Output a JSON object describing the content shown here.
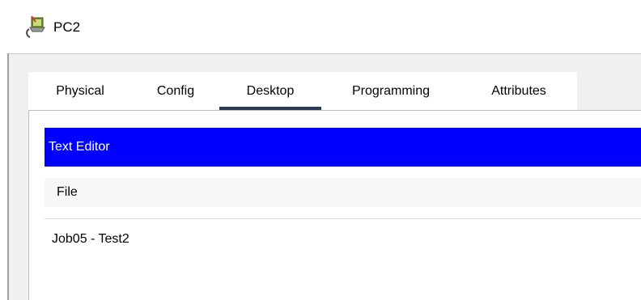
{
  "window": {
    "title": "PC2",
    "icon": "pc-device-icon"
  },
  "tabs": [
    {
      "label": "Physical",
      "active": false
    },
    {
      "label": "Config",
      "active": false
    },
    {
      "label": "Desktop",
      "active": true
    },
    {
      "label": "Programming",
      "active": false
    },
    {
      "label": "Attributes",
      "active": false
    }
  ],
  "app": {
    "title": "Text Editor",
    "header_color": "#0000ff",
    "menu": {
      "file_label": "File"
    },
    "editor": {
      "content": "Job05 - Test2"
    }
  },
  "colors": {
    "active_tab_underline": "#2b3a55"
  }
}
